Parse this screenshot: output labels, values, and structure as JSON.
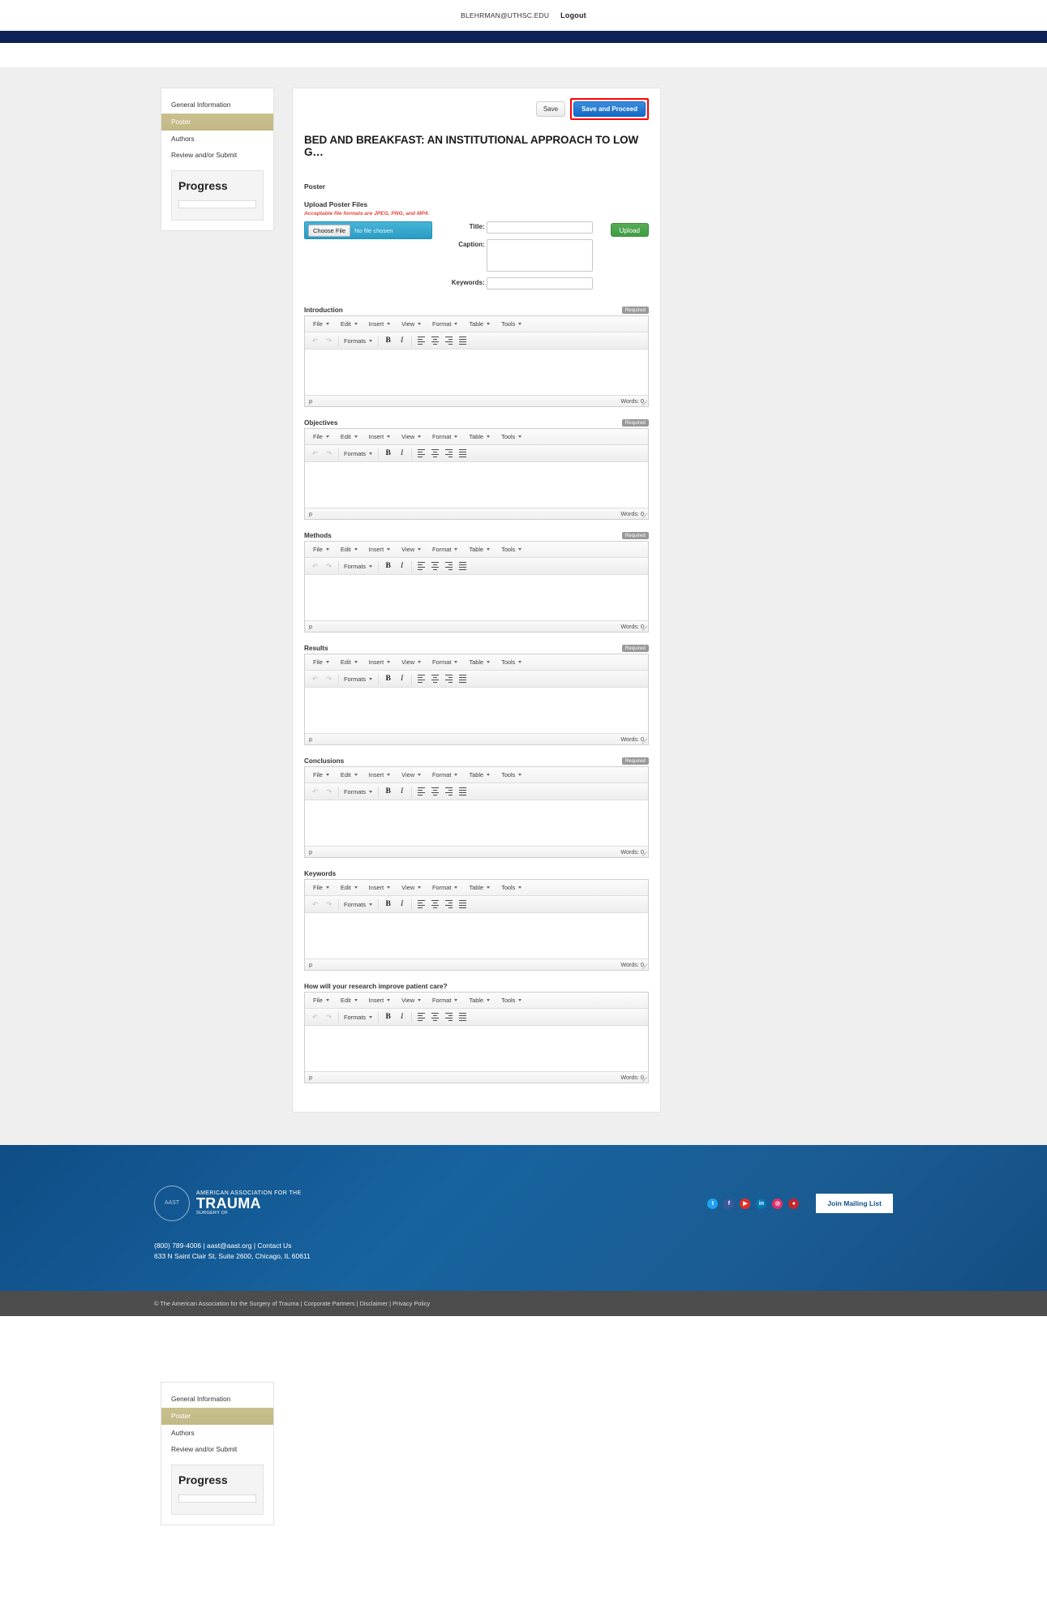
{
  "topbar": {
    "user_email": "BLEHRMAN@UTHSC.EDU",
    "logout_label": "Logout"
  },
  "sidebar": {
    "items": [
      {
        "label": "General Information",
        "active": false
      },
      {
        "label": "Poster",
        "active": true
      },
      {
        "label": "Authors",
        "active": false
      },
      {
        "label": "Review and/or Submit",
        "active": false
      }
    ],
    "progress_title": "Progress",
    "progress_percent": 0
  },
  "main": {
    "save_label": "Save",
    "save_proceed_label": "Save and Proceed",
    "abstract_title": "BED AND BREAKFAST: AN INSTITUTIONAL APPROACH TO LOW G…",
    "section_heading": "Poster",
    "upload_heading": "Upload Poster Files",
    "format_note": "Acceptable file formats are JPEG, PNG, and MP4.",
    "choose_file_label": "Choose File",
    "no_file_chosen": "No file chosen",
    "title_label": "Title:",
    "title_value": "",
    "caption_label": "Caption:",
    "caption_value": "",
    "keywords_label": "Keywords:",
    "keywords_value": "",
    "upload_button": "Upload",
    "required_badge": "Required",
    "editor": {
      "menubar": [
        "File",
        "Edit",
        "Insert",
        "View",
        "Format",
        "Table",
        "Tools"
      ],
      "formats_label": "Formats",
      "undo_icon": "undo-icon",
      "redo_icon": "redo-icon",
      "bold_label": "B",
      "italic_label": "I",
      "status_path": "p",
      "word_count": "Words: 0"
    },
    "sections": [
      {
        "label": "Introduction",
        "required": true,
        "content": ""
      },
      {
        "label": "Objectives",
        "required": true,
        "content": ""
      },
      {
        "label": "Methods",
        "required": true,
        "content": ""
      },
      {
        "label": "Results",
        "required": true,
        "content": ""
      },
      {
        "label": "Conclusions",
        "required": true,
        "content": ""
      },
      {
        "label": "Keywords",
        "required": false,
        "content": ""
      },
      {
        "label": "How will your research improve patient care?",
        "required": false,
        "content": ""
      }
    ]
  },
  "footer": {
    "logo_line1": "AMERICAN ASSOCIATION FOR THE",
    "logo_line2": "TRAUMA",
    "logo_line3": "SURGERY OF",
    "seal_text": "AAST",
    "social": [
      {
        "name": "twitter-icon",
        "glyph": "t",
        "color": "#1da1f2"
      },
      {
        "name": "facebook-icon",
        "glyph": "f",
        "color": "#3b5998"
      },
      {
        "name": "youtube-icon",
        "glyph": "▶",
        "color": "#e52d27"
      },
      {
        "name": "linkedin-icon",
        "glyph": "in",
        "color": "#0077b5"
      },
      {
        "name": "instagram-icon",
        "glyph": "◎",
        "color": "#e1306c"
      },
      {
        "name": "location-icon",
        "glyph": "●",
        "color": "#c1272d"
      }
    ],
    "join_label": "Join Mailing List",
    "contact_line1": "(800) 789-4006 | aast@aast.org | Contact Us",
    "contact_line2": "633 N Saint Clair St, Suite 2600, Chicago, IL 60611",
    "copyright": "© The American Association for the Surgery of Trauma | Corporate Partners | Disclaimer | Privacy Policy"
  },
  "colors": {
    "navy_band": "#0d2257",
    "accent_blue": "#1469c7",
    "highlight_red": "#ff0000",
    "sidebar_active": "#c2b887",
    "upload_green": "#3f9d44",
    "file_blue": "#2a9cc4",
    "note_red": "#e8443a"
  }
}
